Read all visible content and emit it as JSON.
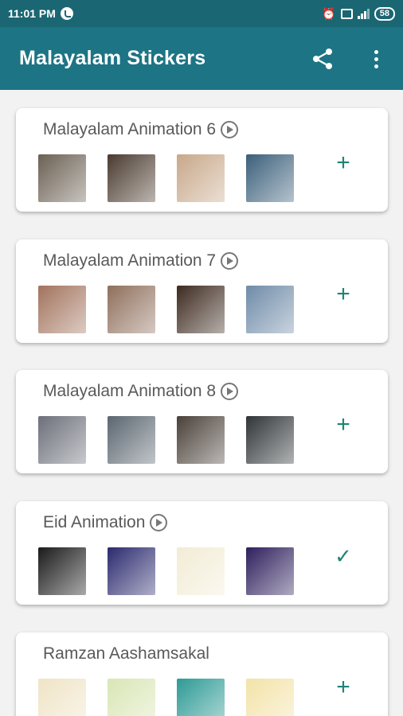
{
  "status_bar": {
    "time": "11:01 PM",
    "battery": "58"
  },
  "app_bar": {
    "title": "Malayalam Stickers",
    "share_icon": "share-icon",
    "more_icon": "more-vert-icon"
  },
  "colors": {
    "app_bar": "#1d7484",
    "status_bar": "#1b6673",
    "accent": "#1d8475"
  },
  "packs": [
    {
      "name": "Malayalam Animation 6",
      "has_play": true,
      "action": "add",
      "action_glyph": "+",
      "thumbs": [
        "#6b6053",
        "#4a3a2e",
        "#c8a88a",
        "#3b5f7a"
      ]
    },
    {
      "name": "Malayalam Animation 7",
      "has_play": true,
      "action": "add",
      "action_glyph": "+",
      "thumbs": [
        "#a2735d",
        "#8f6f5c",
        "#3d2a1f",
        "#6f8ba8"
      ]
    },
    {
      "name": "Malayalam Animation 8",
      "has_play": true,
      "action": "add",
      "action_glyph": "+",
      "thumbs": [
        "#6c6f7a",
        "#5b6670",
        "#4a4039",
        "#2f3437"
      ]
    },
    {
      "name": "Eid Animation",
      "has_play": true,
      "action": "added",
      "action_glyph": "✓",
      "thumbs": [
        "#1a1a1a",
        "#2b2a6e",
        "#f2ecd5",
        "#2e1f5c"
      ]
    },
    {
      "name": "Ramzan Aashamsakal",
      "has_play": false,
      "action": "add",
      "action_glyph": "+",
      "thumbs": [
        "#efe4c6",
        "#d9e6b5",
        "#2e9a95",
        "#f3e3a8"
      ]
    }
  ]
}
